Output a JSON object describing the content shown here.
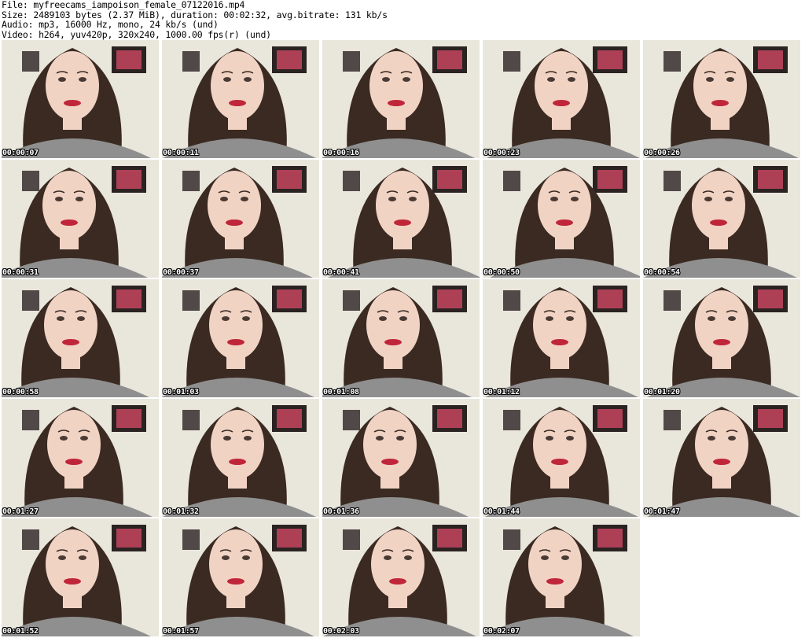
{
  "header": {
    "file_line": "File: myfreecams_iampoison_female_07122016.mp4",
    "size_line": "Size: 2489103 bytes (2.37 MiB), duration: 00:02:32, avg.bitrate: 131 kb/s",
    "audio_line": "Audio: mp3, 16000 Hz, mono, 24 kb/s (und)",
    "video_line": "Video: h264, yuv420p, 320x240, 1000.00 fps(r) (und)"
  },
  "thumbnails": [
    {
      "timestamp": "00:00:07"
    },
    {
      "timestamp": "00:00:11"
    },
    {
      "timestamp": "00:00:16"
    },
    {
      "timestamp": "00:00:23"
    },
    {
      "timestamp": "00:00:26"
    },
    {
      "timestamp": "00:00:31"
    },
    {
      "timestamp": "00:00:37"
    },
    {
      "timestamp": "00:00:41"
    },
    {
      "timestamp": "00:00:50"
    },
    {
      "timestamp": "00:00:54"
    },
    {
      "timestamp": "00:00:58"
    },
    {
      "timestamp": "00:01:03"
    },
    {
      "timestamp": "00:01:08"
    },
    {
      "timestamp": "00:01:12"
    },
    {
      "timestamp": "00:01:20"
    },
    {
      "timestamp": "00:01:27"
    },
    {
      "timestamp": "00:01:32"
    },
    {
      "timestamp": "00:01:36"
    },
    {
      "timestamp": "00:01:44"
    },
    {
      "timestamp": "00:01:47"
    },
    {
      "timestamp": "00:01:52"
    },
    {
      "timestamp": "00:01:57"
    },
    {
      "timestamp": "00:02:03"
    },
    {
      "timestamp": "00:02:07"
    }
  ],
  "colors": {
    "background": "#ffffff",
    "wall": "#e9e6dc",
    "hair": "#3a2a22",
    "skin": "#f1d3c4",
    "lips": "#c0263a",
    "sweater": "#8f8f8f",
    "frame": "#2b2222",
    "frame_art": "#c6455f"
  }
}
